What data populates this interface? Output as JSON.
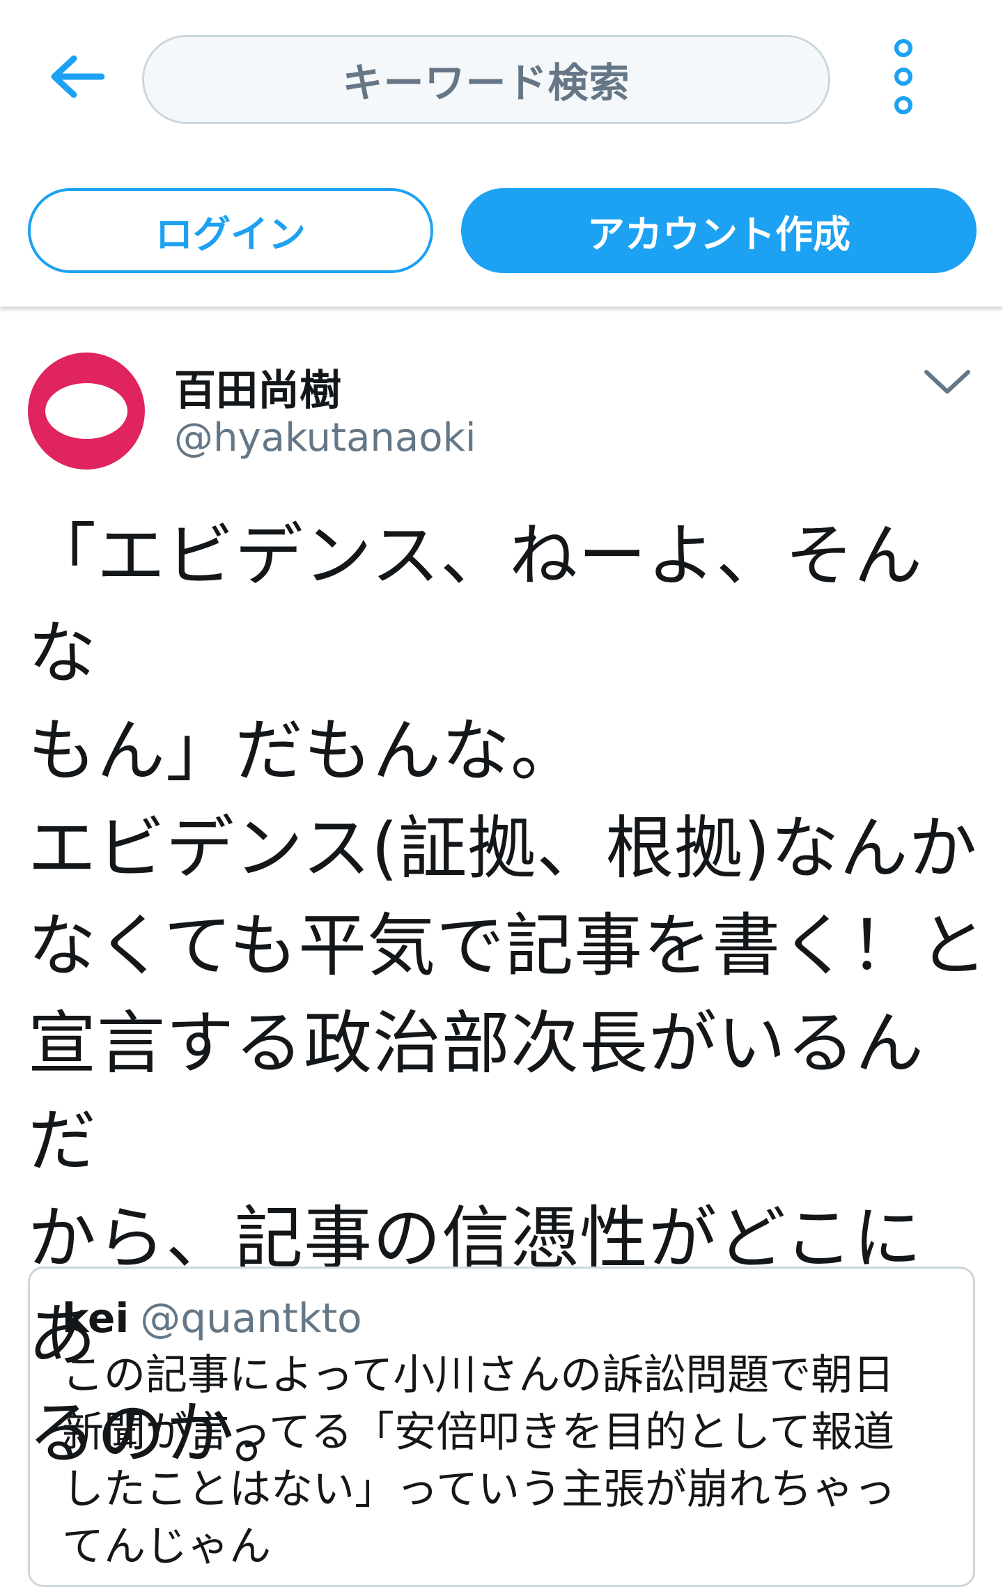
{
  "header": {
    "search_placeholder": "キーワード検索",
    "back_icon": "arrow-left-icon",
    "more_icon": "more-vertical-icon",
    "login_label": "ログイン",
    "signup_label": "アカウント作成",
    "accent_color": "#1da1f2"
  },
  "tweet": {
    "user_name": "百田尚樹",
    "user_handle": "@hyakutanaoki",
    "avatar_color": "#e0245e",
    "caret_icon": "chevron-down-icon",
    "text": "「エビデンス、ねーよ、そんな\nもん」だもんな。\nエビデンス(証拠、根拠)なんか\nなくても平気で記事を書く！と\n宣言する政治部次長がいるんだ\nから、記事の信憑性がどこにあ\nるのか。"
  },
  "quote": {
    "name": "kei",
    "handle": "@quantkto",
    "text": "この記事によって小川さんの訴訟問題で朝日\n新聞が言ってる「安倍叩きを目的として報道\nしたことはない」っていう主張が崩れちゃっ\nてんじゃん"
  }
}
